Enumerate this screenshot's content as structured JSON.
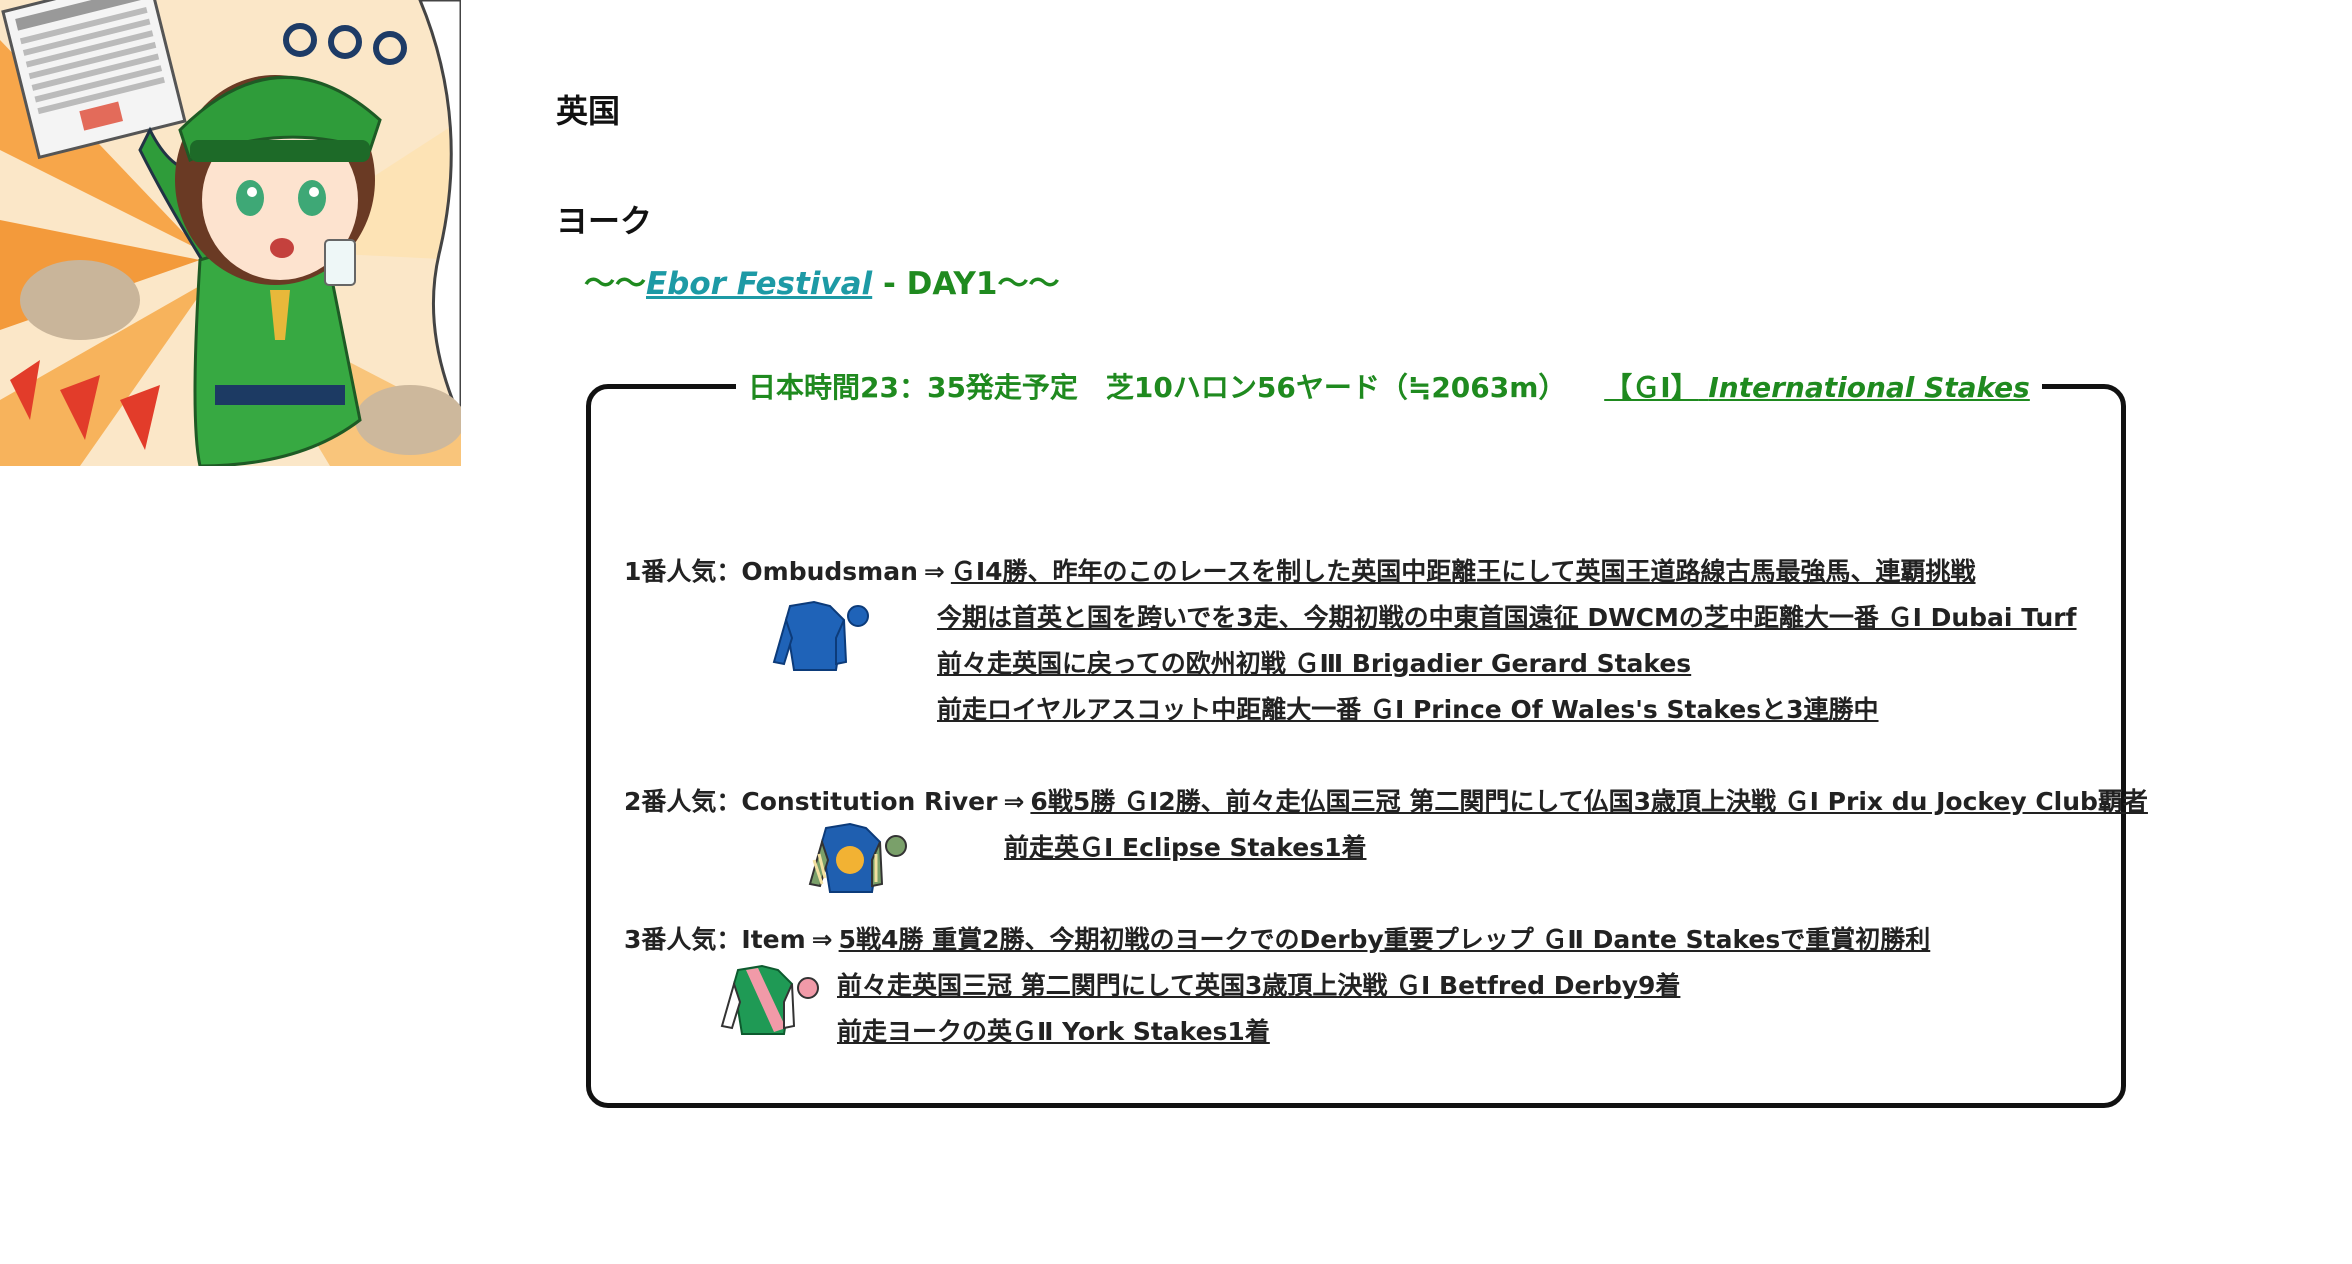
{
  "page": {
    "country": "英国",
    "track": "ヨーク",
    "meeting": {
      "prefix": "〜〜",
      "festival_link": "Ebor Festival",
      "suffix_sep": "-",
      "day": "DAY1〜〜"
    }
  },
  "race": {
    "header_info": "日本時間23：35発走予定　芝10ハロン56ヤード（≒2063m）",
    "grade": "【ＧⅠ】",
    "race_name": "International Stakes"
  },
  "runners": [
    {
      "rank_label": "1番人気：Ombudsman",
      "arrow": "⇒",
      "silk_icon": "blue-jacket-silk-icon",
      "lines": [
        "ＧⅠ4勝、昨年のこのレースを制した英国中距離王にして英国王道路線古馬最強馬、連覇挑戦",
        "今期は首英と国を跨いでを3走、今期初戦の中東首国遠征 DWCMの芝中距離大一番 ＧⅠ Dubai Turf",
        "前々走英国に戻っての欧州初戦 ＧⅢ Brigadier Gerard Stakes",
        "前走ロイヤルアスコット中距離大一番 ＧⅠ Prince Of Wales's Stakesと3連勝中"
      ]
    },
    {
      "rank_label": "2番人気：Constitution River",
      "arrow": "⇒",
      "silk_icon": "blue-yellow-disc-silk-icon",
      "lines": [
        "6戦5勝 ＧⅠ2勝、前々走仏国三冠 第二関門にして仏国3歳頂上決戦 ＧⅠ Prix du Jockey Club覇者",
        "前走英ＧⅠ Eclipse Stakes1着"
      ]
    },
    {
      "rank_label": "3番人気：Item",
      "arrow": "⇒",
      "silk_icon": "green-pink-sash-silk-icon",
      "lines": [
        "5戦4勝 重賞2勝、今期初戦のヨークでのDerby重要プレップ ＧⅡ Dante Stakesで重賞初勝利",
        "前々走英国三冠 第二関門にして英国3歳頂上決戦 ＧⅠ Betfred Derby9着",
        "前走ヨークの英ＧⅡ York Stakes1着"
      ]
    }
  ],
  "colors": {
    "green_text": "#1f8a1f",
    "teal_link": "#1d9aa5",
    "box_border": "#111111"
  }
}
